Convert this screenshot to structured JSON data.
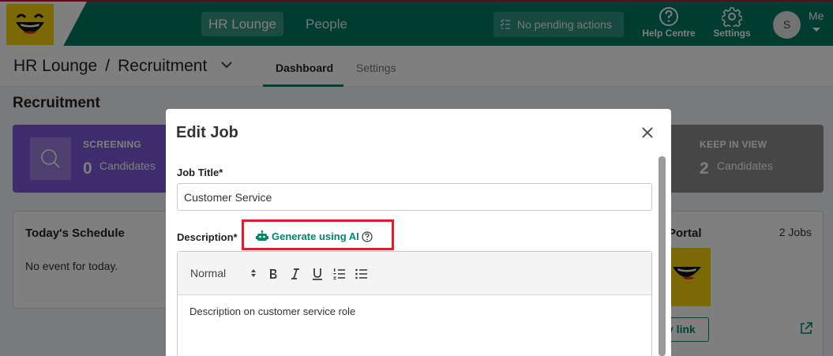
{
  "header": {
    "logo_text": "smile",
    "nav": [
      {
        "label": "HR Lounge",
        "active": true
      },
      {
        "label": "People",
        "active": false
      }
    ],
    "pending_actions": "No pending actions",
    "help_label": "Help Centre",
    "settings_label": "Settings",
    "avatar_initial": "S",
    "me_label": "Me"
  },
  "subheader": {
    "breadcrumb": [
      "HR Lounge",
      "Recruitment"
    ],
    "separator": "/",
    "tabs": [
      {
        "label": "Dashboard",
        "active": true
      },
      {
        "label": "Settings",
        "active": false
      }
    ]
  },
  "page": {
    "title": "Recruitment",
    "stats": [
      {
        "label": "SCREENING",
        "count": "0",
        "sub": "Candidates",
        "color": "#7b5ad9"
      },
      {
        "label": "KEEP IN VIEW",
        "count": "2",
        "sub": "Candidates",
        "color": "#8c8c8c"
      }
    ],
    "schedule": {
      "title": "Today's Schedule",
      "empty": "No event for today."
    },
    "portal": {
      "title": "Portal",
      "jobs": "2 Jobs",
      "copy_link": "y link"
    }
  },
  "modal": {
    "title": "Edit Job",
    "job_title_label": "Job Title*",
    "job_title_value": "Customer Service",
    "description_label": "Description*",
    "generate_ai_label": "Generate using AI",
    "editor": {
      "format_value": "Normal",
      "toolbar_icons": [
        "bold-icon",
        "italic-icon",
        "underline-icon",
        "ordered-list-icon",
        "bullet-list-icon"
      ],
      "content": "Description on customer service role"
    }
  },
  "colors": {
    "brand_green": "#007a63",
    "accent_green": "#00876b",
    "highlight_red": "#d6222a",
    "logo_yellow": "#f5d20a"
  }
}
